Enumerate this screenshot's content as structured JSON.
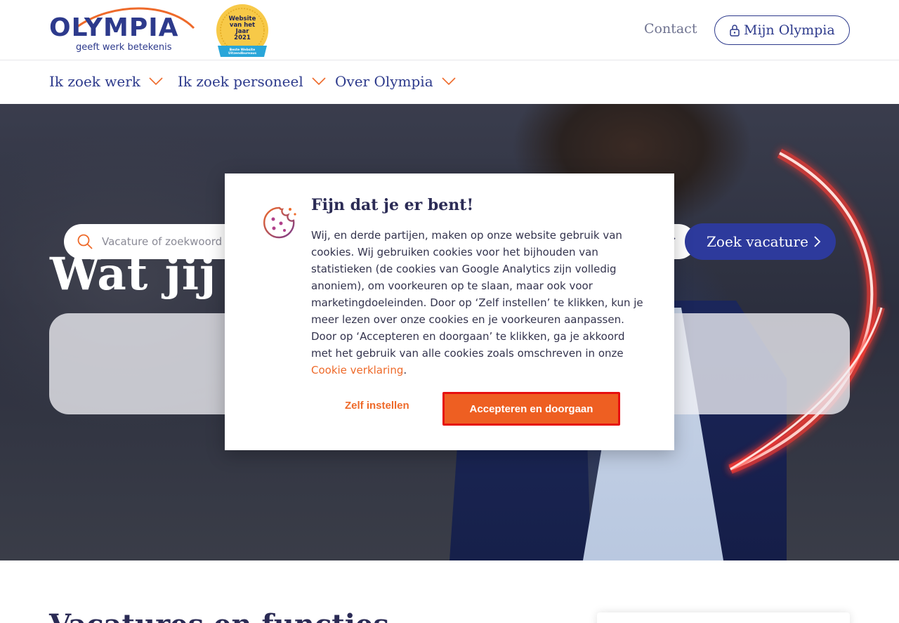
{
  "header": {
    "logo_text": "OLYMPIA",
    "logo_tagline": "geeft werk betekenis",
    "award": {
      "line1": "Website",
      "line2": "van het",
      "line3": "Jaar",
      "line4": "2021",
      "ribbon": "Beste Website Uitzendbureaus"
    },
    "contact_label": "Contact",
    "account_label": "Mijn Olympia"
  },
  "nav": {
    "items": [
      {
        "label": "Ik zoek werk"
      },
      {
        "label": "Ik zoek personeel"
      },
      {
        "label": "Over Olympia"
      }
    ]
  },
  "hero": {
    "title": "Wat jij do",
    "search": {
      "placeholder": "Vacature of zoekwoord",
      "button_label": "Zoek vacature"
    }
  },
  "cookie_modal": {
    "title": "Fijn dat je er bent!",
    "body": "Wij, en derde partijen, maken op onze website gebruik van cookies. Wij gebruiken cookies voor het bijhouden van statistieken (de cookies van Google Analytics zijn volledig anoniem), om voorkeuren op te slaan, maar ook voor marketingdoeleinden. Door op ‘Zelf instellen’ te klikken, kun je meer lezen over onze cookies en je voorkeuren aanpassen. Door op ‘Accepteren en doorgaan’ te klikken, ga je akkoord met het gebruik van alle cookies zoals omschreven in onze ",
    "link_label": "Cookie verklaring",
    "body_end": ".",
    "settings_label": "Zelf instellen",
    "accept_label": "Accepteren en doorgaan"
  },
  "lower": {
    "title": "Vacatures en functies"
  },
  "colors": {
    "brand_blue": "#2d3a8c",
    "brand_orange": "#ee6a2a",
    "accept_bg": "#ee5f22",
    "accept_border": "#e61010",
    "search_button": "#2d3a9c"
  }
}
